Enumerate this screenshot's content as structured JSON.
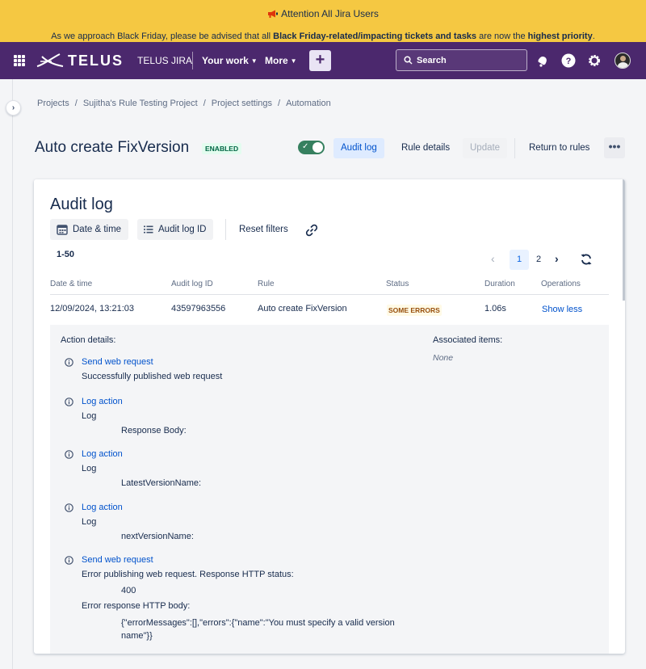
{
  "banner": {
    "title": "Attention All Jira Users",
    "message_prefix": "As we approach Black Friday, please be advised that all ",
    "message_bold1": "Black Friday-related/impacting tickets and tasks",
    "message_mid": " are now the ",
    "message_bold2": "highest priority",
    "message_suffix": "."
  },
  "topnav": {
    "logo": "TELUS",
    "product": "TELUS JIRA",
    "your_work": "Your work",
    "more": "More",
    "create": "+",
    "search_placeholder": "Search",
    "colors": {
      "background": "#4b286d"
    }
  },
  "breadcrumb": [
    "Projects",
    "Sujitha's Rule Testing Project",
    "Project settings",
    "Automation"
  ],
  "rule_header": {
    "title": "Auto create FixVersion",
    "status": "ENABLED",
    "audit_log": "Audit log",
    "rule_details": "Rule details",
    "update": "Update",
    "return_to_rules": "Return to rules",
    "more": "•••"
  },
  "audit": {
    "heading": "Audit log",
    "filter_date": "Date & time",
    "filter_auditid": "Audit log ID",
    "reset_filters": "Reset filters",
    "range": "1-50",
    "pages": [
      "1",
      "2"
    ],
    "current_page": "1",
    "columns": [
      "Date & time",
      "Audit log ID",
      "Rule",
      "Status",
      "Duration",
      "Operations"
    ],
    "row": {
      "date": "12/09/2024, 13:21:03",
      "id": "43597963556",
      "rule": "Auto create FixVersion",
      "status": "SOME ERRORS",
      "duration": "1.06s",
      "operation": "Show less"
    },
    "details": {
      "action_details": "Action details:",
      "associated_items": "Associated items:",
      "associated_none": "None",
      "actions": [
        {
          "title": "Send web request",
          "line1": "Successfully published web request"
        },
        {
          "title": "Log action",
          "line1": "Log",
          "line2": "Response Body:"
        },
        {
          "title": "Log action",
          "line1": "Log",
          "line2": "LatestVersionName:"
        },
        {
          "title": "Log action",
          "line1": "Log",
          "line2": "nextVersionName:"
        },
        {
          "title": "Send web request",
          "line1": "Error publishing web request. Response HTTP status:",
          "line2": "400",
          "line3": "Error response HTTP body:",
          "line4": "{\"errorMessages\":[],\"errors\":{\"name\":\"You must specify a valid version name\"}}"
        }
      ]
    }
  }
}
